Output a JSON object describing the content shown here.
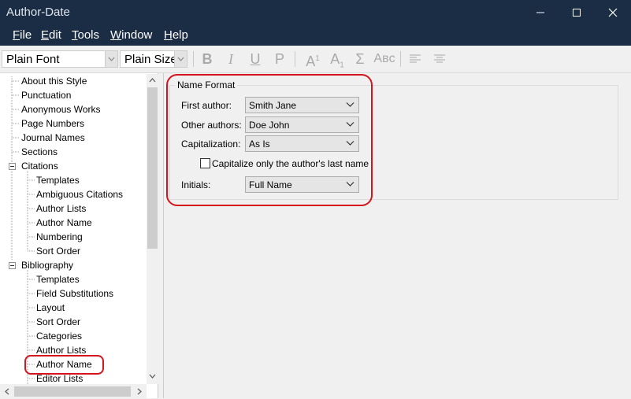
{
  "window": {
    "title": "Author-Date"
  },
  "menu": {
    "items": [
      {
        "key": "F",
        "rest": "ile"
      },
      {
        "key": "E",
        "rest": "dit"
      },
      {
        "key": "T",
        "rest": "ools"
      },
      {
        "key": "W",
        "rest": "indow"
      },
      {
        "key": "H",
        "rest": "elp"
      }
    ]
  },
  "toolbar": {
    "font": "Plain Font",
    "size": "Plain Size",
    "bold": "B",
    "italic": "I",
    "underline": "U",
    "plain": "P",
    "superscript": "A",
    "superscript_mark": "1",
    "subscript": "A",
    "subscript_mark": "1",
    "symbol": "Σ",
    "smallcaps": "Aʙᴄ"
  },
  "tree": {
    "items": [
      {
        "label": "About this Style"
      },
      {
        "label": "Punctuation"
      },
      {
        "label": "Anonymous Works"
      },
      {
        "label": "Page Numbers"
      },
      {
        "label": "Journal Names"
      },
      {
        "label": "Sections"
      },
      {
        "label": "Citations"
      },
      {
        "label": "Templates"
      },
      {
        "label": "Ambiguous Citations"
      },
      {
        "label": "Author Lists"
      },
      {
        "label": "Author Name"
      },
      {
        "label": "Numbering"
      },
      {
        "label": "Sort Order"
      },
      {
        "label": "Bibliography"
      },
      {
        "label": "Templates"
      },
      {
        "label": "Field Substitutions"
      },
      {
        "label": "Layout"
      },
      {
        "label": "Sort Order"
      },
      {
        "label": "Categories"
      },
      {
        "label": "Author Lists"
      },
      {
        "label": "Author Name"
      },
      {
        "label": "Editor Lists"
      }
    ]
  },
  "name_format": {
    "legend": "Name Format",
    "first_author_label": "First author:",
    "first_author_value": "Smith Jane",
    "other_authors_label": "Other authors:",
    "other_authors_value": "Doe John",
    "capitalization_label": "Capitalization:",
    "capitalization_value": "As Is",
    "capitalize_last_label": "Capitalize only the author's last name",
    "capitalize_last_checked": false,
    "initials_label": "Initials:",
    "initials_value": "Full Name"
  },
  "colors": {
    "titlebar": "#1b2c45",
    "highlight": "#d4151d"
  }
}
